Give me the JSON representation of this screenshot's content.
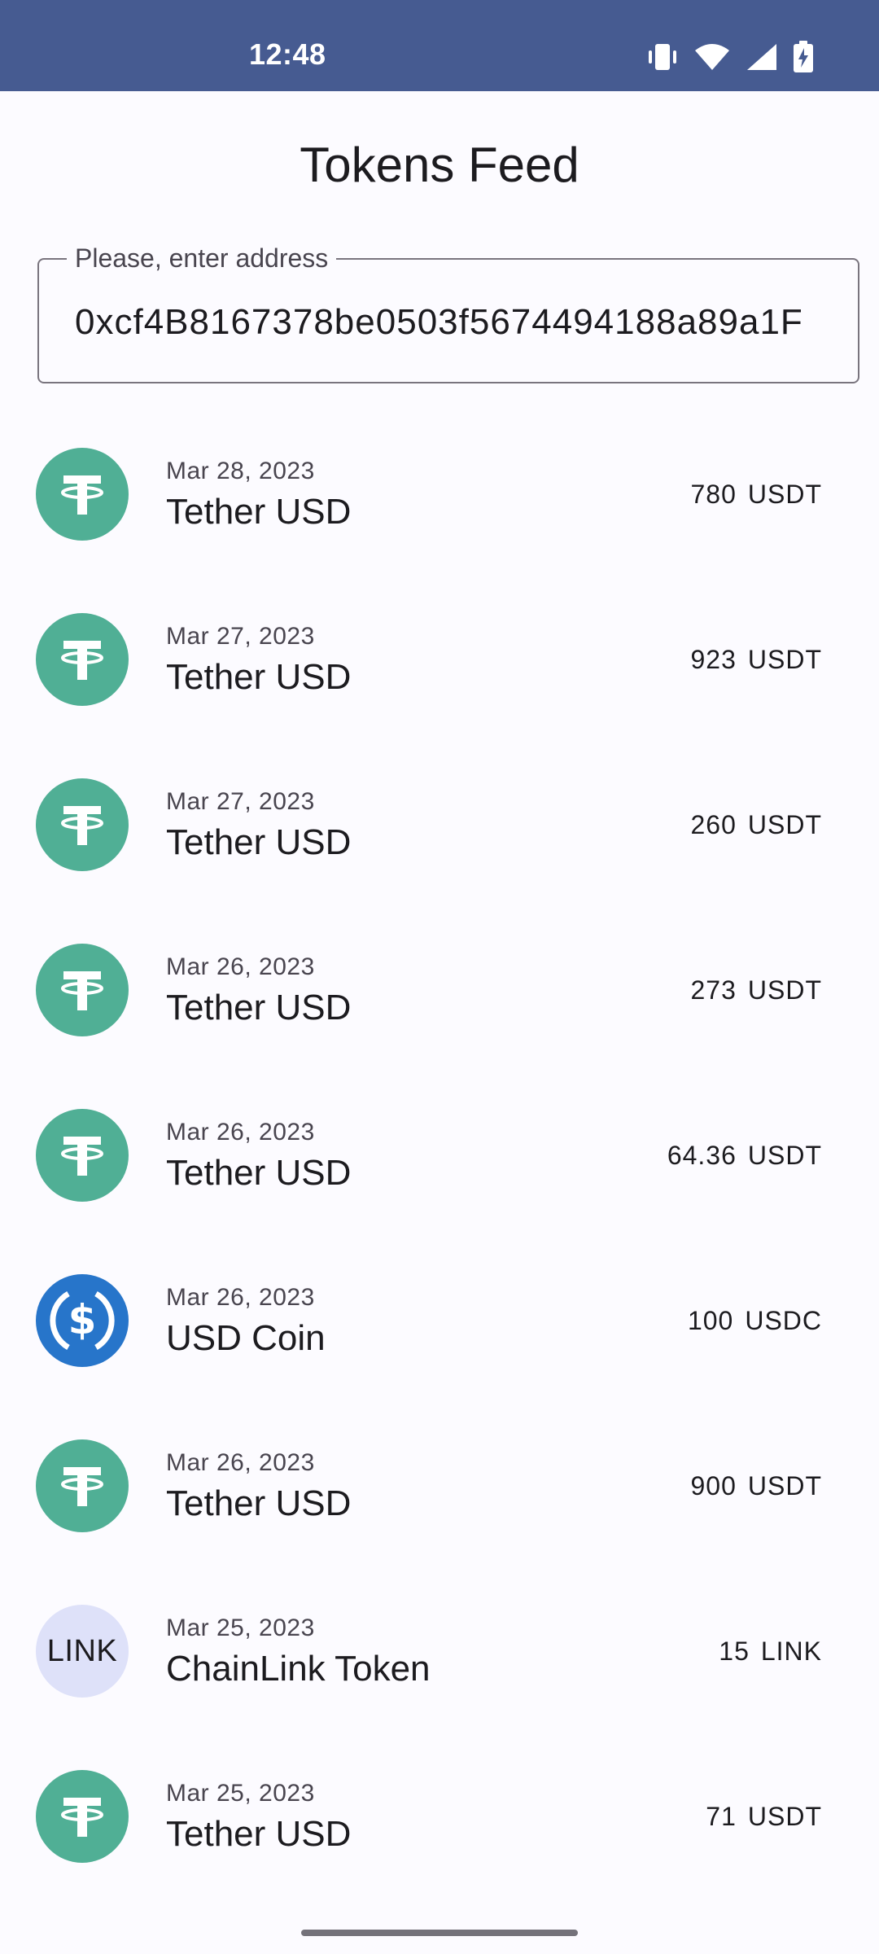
{
  "status_bar": {
    "time": "12:48",
    "icons": [
      "vibrate-icon",
      "wifi-icon",
      "signal-icon",
      "battery-charging-icon"
    ],
    "background": "#465b91"
  },
  "header": {
    "title": "Tokens Feed"
  },
  "address_field": {
    "label": "Please, enter address",
    "value": "0xcf4B8167378be0503f5674494188a89a1F"
  },
  "colors": {
    "usdt": "#50af95",
    "usdc": "#2775ca",
    "link": "#dee1f9",
    "accent": "#465b91"
  },
  "transactions": [
    {
      "date": "Mar 28, 2023",
      "name": "Tether USD",
      "amount": "780",
      "symbol": "USDT",
      "icon": "tether-icon"
    },
    {
      "date": "Mar 27, 2023",
      "name": "Tether USD",
      "amount": "923",
      "symbol": "USDT",
      "icon": "tether-icon"
    },
    {
      "date": "Mar 27, 2023",
      "name": "Tether USD",
      "amount": "260",
      "symbol": "USDT",
      "icon": "tether-icon"
    },
    {
      "date": "Mar 26, 2023",
      "name": "Tether USD",
      "amount": "273",
      "symbol": "USDT",
      "icon": "tether-icon"
    },
    {
      "date": "Mar 26, 2023",
      "name": "Tether USD",
      "amount": "64.36",
      "symbol": "USDT",
      "icon": "tether-icon"
    },
    {
      "date": "Mar 26, 2023",
      "name": "USD Coin",
      "amount": "100",
      "symbol": "USDC",
      "icon": "usd-coin-icon"
    },
    {
      "date": "Mar 26, 2023",
      "name": "Tether USD",
      "amount": "900",
      "symbol": "USDT",
      "icon": "tether-icon"
    },
    {
      "date": "Mar 25, 2023",
      "name": "ChainLink Token",
      "amount": "15",
      "symbol": "LINK",
      "icon": "chainlink-icon",
      "icon_text": "LINK"
    },
    {
      "date": "Mar 25, 2023",
      "name": "Tether USD",
      "amount": "71",
      "symbol": "USDT",
      "icon": "tether-icon"
    }
  ]
}
